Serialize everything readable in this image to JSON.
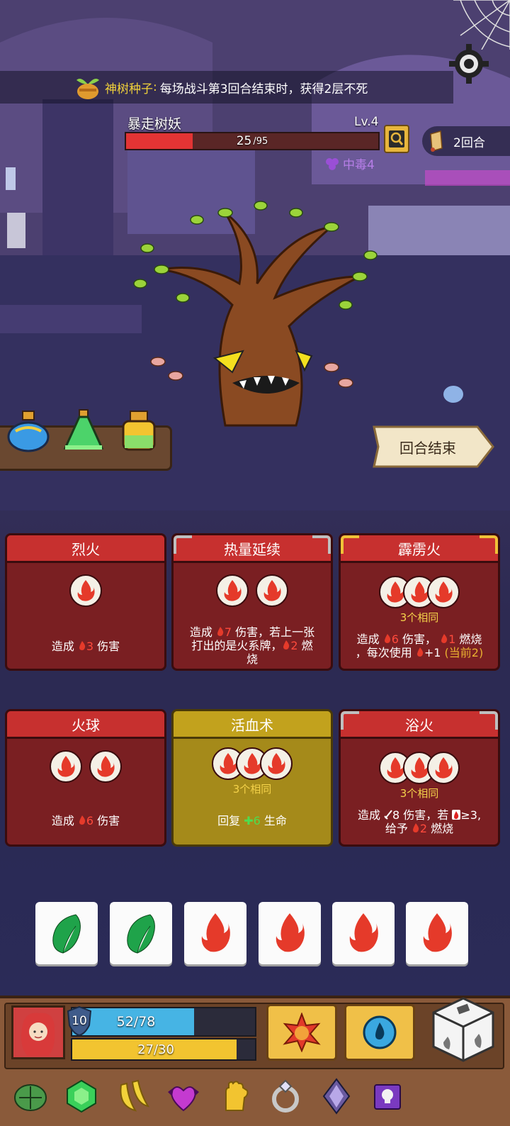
{
  "relic_banner": {
    "name": "神树种子",
    "colon": ":",
    "description": "每场战斗第3回合结束时，获得2层不死"
  },
  "enemy": {
    "name": "暴走树妖",
    "level": "Lv.4",
    "hp_current": "25",
    "hp_max": "/95",
    "hp_fraction": 0.263,
    "status": "中毒4"
  },
  "turn": {
    "label": "2回合"
  },
  "end_turn_button": {
    "label": "回合结束"
  },
  "cards": [
    {
      "title": "烈火",
      "style": "red",
      "same": "",
      "desc_parts": [
        "造成 ",
        "3",
        " 伤害"
      ]
    },
    {
      "title": "热量延续",
      "style": "red",
      "same": "",
      "desc_line1_a": "造成 ",
      "desc_line1_b": "7",
      "desc_line1_c": " 伤害，若上一张",
      "desc_line2_a": "打出的是火系牌，",
      "desc_line2_b": "2",
      "desc_line2_c": " 燃",
      "desc_line3": "烧"
    },
    {
      "title": "霹雳火",
      "style": "red",
      "same": "3个相同",
      "desc_line1_a": "造成 ",
      "desc_line1_b": "6",
      "desc_line1_c": " 伤害， ",
      "desc_line1_d": "1",
      "desc_line1_e": " 燃烧",
      "desc_line2_a": "，每次使用 ",
      "desc_line2_b": "+1 ",
      "desc_line2_c": "(当前2)"
    },
    {
      "title": "火球",
      "style": "red",
      "same": "",
      "desc_parts": [
        "造成 ",
        "6",
        " 伤害"
      ]
    },
    {
      "title": "活血术",
      "style": "gold",
      "same": "3个相同",
      "desc_parts": [
        "回复 ",
        "6",
        " 生命"
      ]
    },
    {
      "title": "浴火",
      "style": "red",
      "same": "3个相同",
      "desc_line1_a": "造成 ",
      "desc_line1_b": "8 伤害，若 ",
      "desc_line1_c": "≥3,",
      "desc_line2_a": "给予 ",
      "desc_line2_b": "2",
      "desc_line2_c": " 燃烧"
    }
  ],
  "dice": [
    "leaf",
    "leaf",
    "fire",
    "fire",
    "fire",
    "fire"
  ],
  "player": {
    "level": "10",
    "hp": "52/78",
    "hp_fraction": 0.667,
    "energy": "27/30",
    "energy_fraction": 0.9
  },
  "relics": [
    "turtle-shell-icon",
    "green-gem-icon",
    "bananas-icon",
    "bat-heart-icon",
    "glove-icon",
    "ring-icon",
    "crystal-icon",
    "skull-book-icon"
  ],
  "colors": {
    "card_red": "#c7302f",
    "card_gold": "#c2a21d",
    "fire": "#e53a2a",
    "leaf": "#1fa34a",
    "hp_bar": "#46b4e4",
    "energy_bar": "#f2c430"
  }
}
